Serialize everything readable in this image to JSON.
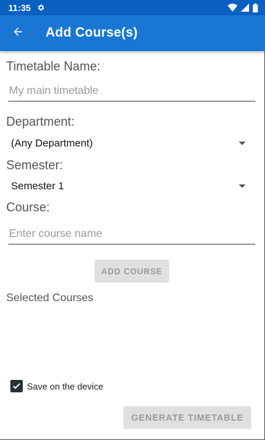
{
  "status_bar": {
    "time": "11:35",
    "icons": [
      "settings-gear-icon",
      "wifi-icon",
      "signal-icon",
      "battery-icon"
    ]
  },
  "app_bar": {
    "title": "Add Course(s)",
    "back_icon": "arrow-back-icon"
  },
  "form": {
    "timetable_name_label": "Timetable Name:",
    "timetable_name_placeholder": "My main timetable",
    "department_label": "Department:",
    "department_selected": "(Any Department)",
    "semester_label": "Semester:",
    "semester_selected": "Semester 1",
    "course_label": "Course:",
    "course_placeholder": "Enter course name",
    "add_course_button": "ADD COURSE"
  },
  "selected_courses": {
    "title": "Selected Courses",
    "items": []
  },
  "footer": {
    "save_label": "Save on the device",
    "save_checked": true,
    "generate_button": "GENERATE TIMETABLE"
  },
  "colors": {
    "status_bar": "#0a60c0",
    "app_bar": "#1976d2",
    "checkbox": "#263238",
    "disabled_button_bg": "#e0e0e0",
    "disabled_button_text": "#9a9a9a"
  }
}
